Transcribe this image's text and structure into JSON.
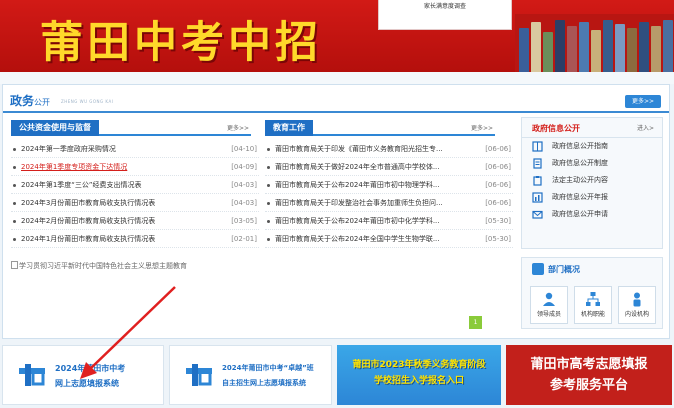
{
  "banner": {
    "title": "莆田中考中招",
    "survey_text": "家长满意度调查"
  },
  "affairs": {
    "title": "政务",
    "subtitle": "公开",
    "subtitle_en": "ZHENG WU GONG KAI",
    "more_label": "更多>>"
  },
  "public_funds": {
    "heading": "公共资金使用与监督",
    "more": "更多>>",
    "items": [
      {
        "title": "2024年第一季度政府采购情况",
        "date": "[04-10]",
        "highlight": false
      },
      {
        "title": "2024年第1季度专项资金下达情况",
        "date": "[04-09]",
        "highlight": true
      },
      {
        "title": "2024年第1季度“三公”经费支出情况表",
        "date": "[04-03]",
        "highlight": false
      },
      {
        "title": "2024年3月份莆田市教育局收支执行情况表",
        "date": "[04-03]",
        "highlight": false
      },
      {
        "title": "2024年2月份莆田市教育局收支执行情况表",
        "date": "[03-05]",
        "highlight": false
      },
      {
        "title": "2024年1月份莆田市教育局收支执行情况表",
        "date": "[02-01]",
        "highlight": false
      }
    ]
  },
  "education_work": {
    "heading": "教育工作",
    "more": "更多>>",
    "items": [
      {
        "title": "莆田市教育局关于印发《莆田市义务教育阳光招生专...",
        "date": "[06-06]"
      },
      {
        "title": "莆田市教育局关于做好2024年全市普通高中学校体...",
        "date": "[06-06]"
      },
      {
        "title": "莆田市教育局关于公布2024年莆田市初中物理学科...",
        "date": "[06-06]"
      },
      {
        "title": "莆田市教育局关于印发整治社会事务加重师生负担问...",
        "date": "[06-06]"
      },
      {
        "title": "莆田市教育局关于公布2024年莆田市初中化学学科...",
        "date": "[05-30]"
      },
      {
        "title": "莆田市教育局关于公布2024年全国中学生生物学联...",
        "date": "[05-30]"
      }
    ]
  },
  "broken_image_alt": "学习贯彻习近平新时代中国特色社会主义思想主题教育",
  "green_badge": "1",
  "gov_info": {
    "heading": "政府信息公开",
    "enter": "进入>",
    "items": [
      {
        "label": "政府信息公开指南",
        "icon": "book-icon"
      },
      {
        "label": "政府信息公开制度",
        "icon": "document-icon"
      },
      {
        "label": "法定主动公开内容",
        "icon": "clipboard-icon"
      },
      {
        "label": "政府信息公开年报",
        "icon": "report-icon"
      },
      {
        "label": "政府信息公开申请",
        "icon": "mail-icon"
      }
    ]
  },
  "dept": {
    "heading": "部门概况",
    "items": [
      {
        "label": "领导成员",
        "icon": "leader-icon"
      },
      {
        "label": "机构职能",
        "icon": "org-chart-icon"
      },
      {
        "label": "内设机构",
        "icon": "person-icon"
      }
    ]
  },
  "promos": {
    "p1_line1": "2024年莆田市中考",
    "p1_line2": "网上志愿填报系统",
    "p2_line1": "2024年莆田市中考“卓越”班",
    "p2_line2": "自主招生网上志愿填报系统",
    "p3_line1": "莆田市2023年秋季义务教育阶段",
    "p3_line2": "学校招生入学报名入口",
    "p4_line1": "莆田市高考志愿填报",
    "p4_line2": "参考服务平台"
  },
  "colors": {
    "banner_red": "#c8161d",
    "banner_title_yellow": "#ffd92a",
    "accent_blue": "#1f6fc4",
    "highlight_red": "#d4201c"
  }
}
